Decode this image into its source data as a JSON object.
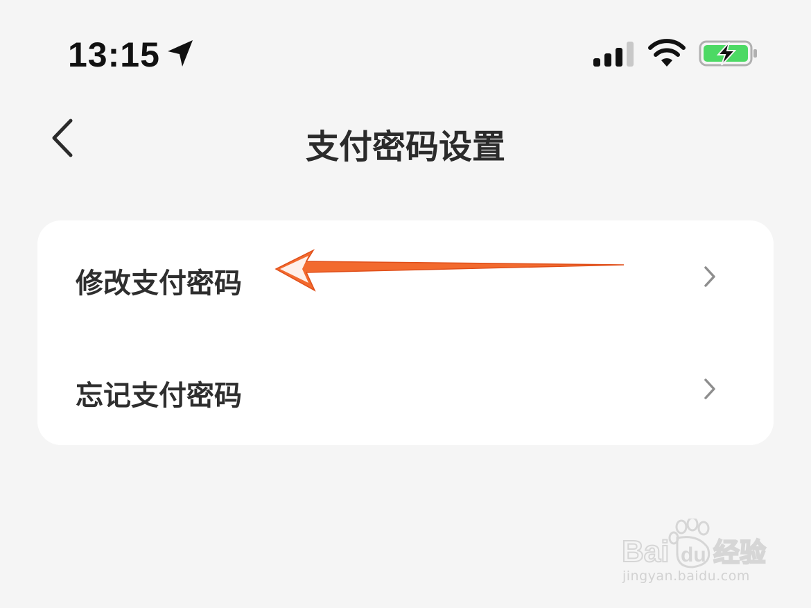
{
  "status_bar": {
    "time": "13:15",
    "location_icon": "location-arrow-icon",
    "signal_icon": "cellular-signal-icon",
    "wifi_icon": "wifi-icon",
    "battery_icon": "battery-charging-icon",
    "battery_color": "#4cd964"
  },
  "nav": {
    "back_icon": "chevron-left-icon",
    "title": "支付密码设置"
  },
  "menu": {
    "items": [
      {
        "label": "修改支付密码",
        "icon": "chevron-right-icon"
      },
      {
        "label": "忘记支付密码",
        "icon": "chevron-right-icon"
      }
    ]
  },
  "annotation": {
    "type": "arrow",
    "color": "#f26a2e",
    "points_to": "修改支付密码"
  },
  "watermark": {
    "logo_text": "Bai du 经验",
    "url": "jingyan.baidu.com"
  },
  "colors": {
    "background": "#f5f5f5",
    "card": "#ffffff",
    "text": "#2e2e2e",
    "chevron": "#8e8e8e"
  }
}
